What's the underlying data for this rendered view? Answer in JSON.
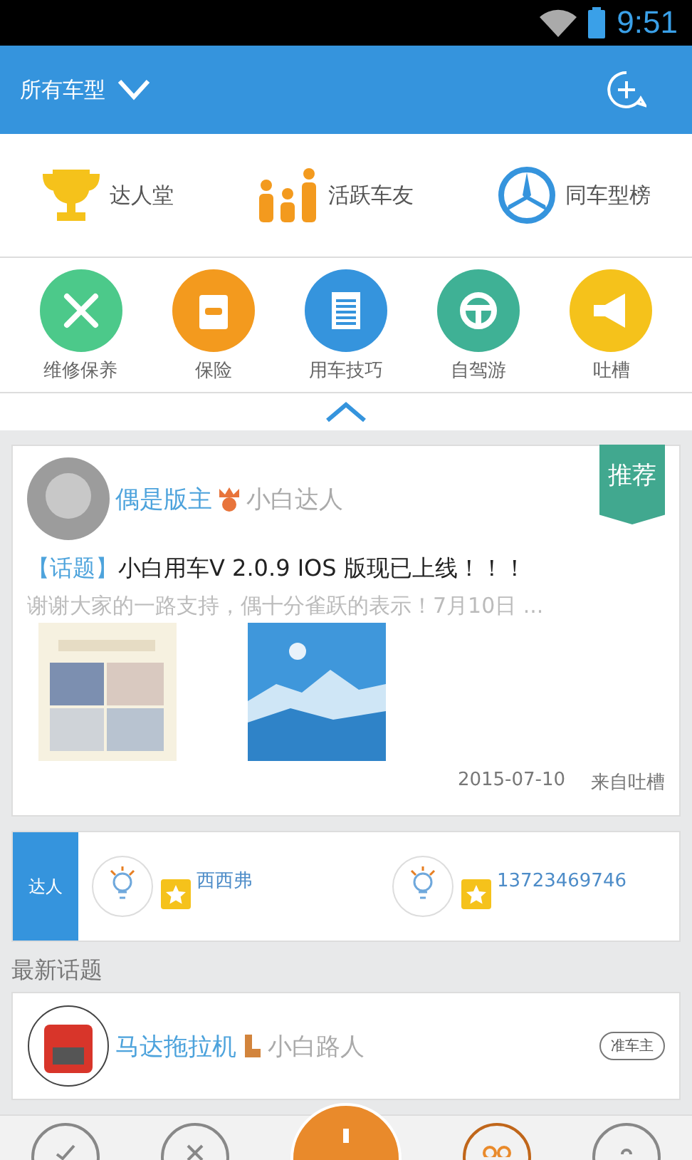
{
  "status_bar": {
    "time": "9:51"
  },
  "header": {
    "title": "所有车型"
  },
  "shortcuts": [
    {
      "label": "达人堂",
      "kind": "trophy"
    },
    {
      "label": "活跃车友",
      "kind": "podium"
    },
    {
      "label": "同车型榜",
      "kind": "wheel"
    }
  ],
  "categories": [
    {
      "label": "维修保养",
      "kind": "tools",
      "color": "#4cc98a"
    },
    {
      "label": "保险",
      "kind": "card",
      "color": "#f39a1e"
    },
    {
      "label": "用车技巧",
      "kind": "doc",
      "color": "#3594dd"
    },
    {
      "label": "自驾游",
      "kind": "wheel",
      "color": "#3fb195"
    },
    {
      "label": "吐槽",
      "kind": "horn",
      "color": "#f5c21b"
    }
  ],
  "featured_post": {
    "author": "偶是版主",
    "rank": "小白达人",
    "badge": "推荐",
    "tag": "【话题】",
    "title": "小白用车V 2.0.9 IOS 版现已上线！！！",
    "excerpt": "谢谢大家的一路支持，偶十分雀跃的表示！7月10日 ...",
    "date": "2015-07-10",
    "source": "来自吐槽"
  },
  "talents": {
    "label": "达人",
    "users": [
      {
        "name": "西西弗"
      },
      {
        "name": "13723469746"
      }
    ]
  },
  "latest": {
    "heading": "最新话题",
    "posts": [
      {
        "author": "马达拖拉机",
        "rank": "小白路人",
        "role": "准车主"
      }
    ]
  },
  "bottom_nav": [
    {
      "kind": "check",
      "selected": false
    },
    {
      "kind": "cross",
      "selected": false
    },
    {
      "kind": "plus",
      "selected": false
    },
    {
      "kind": "chat",
      "selected": true
    },
    {
      "kind": "question",
      "selected": false
    }
  ]
}
